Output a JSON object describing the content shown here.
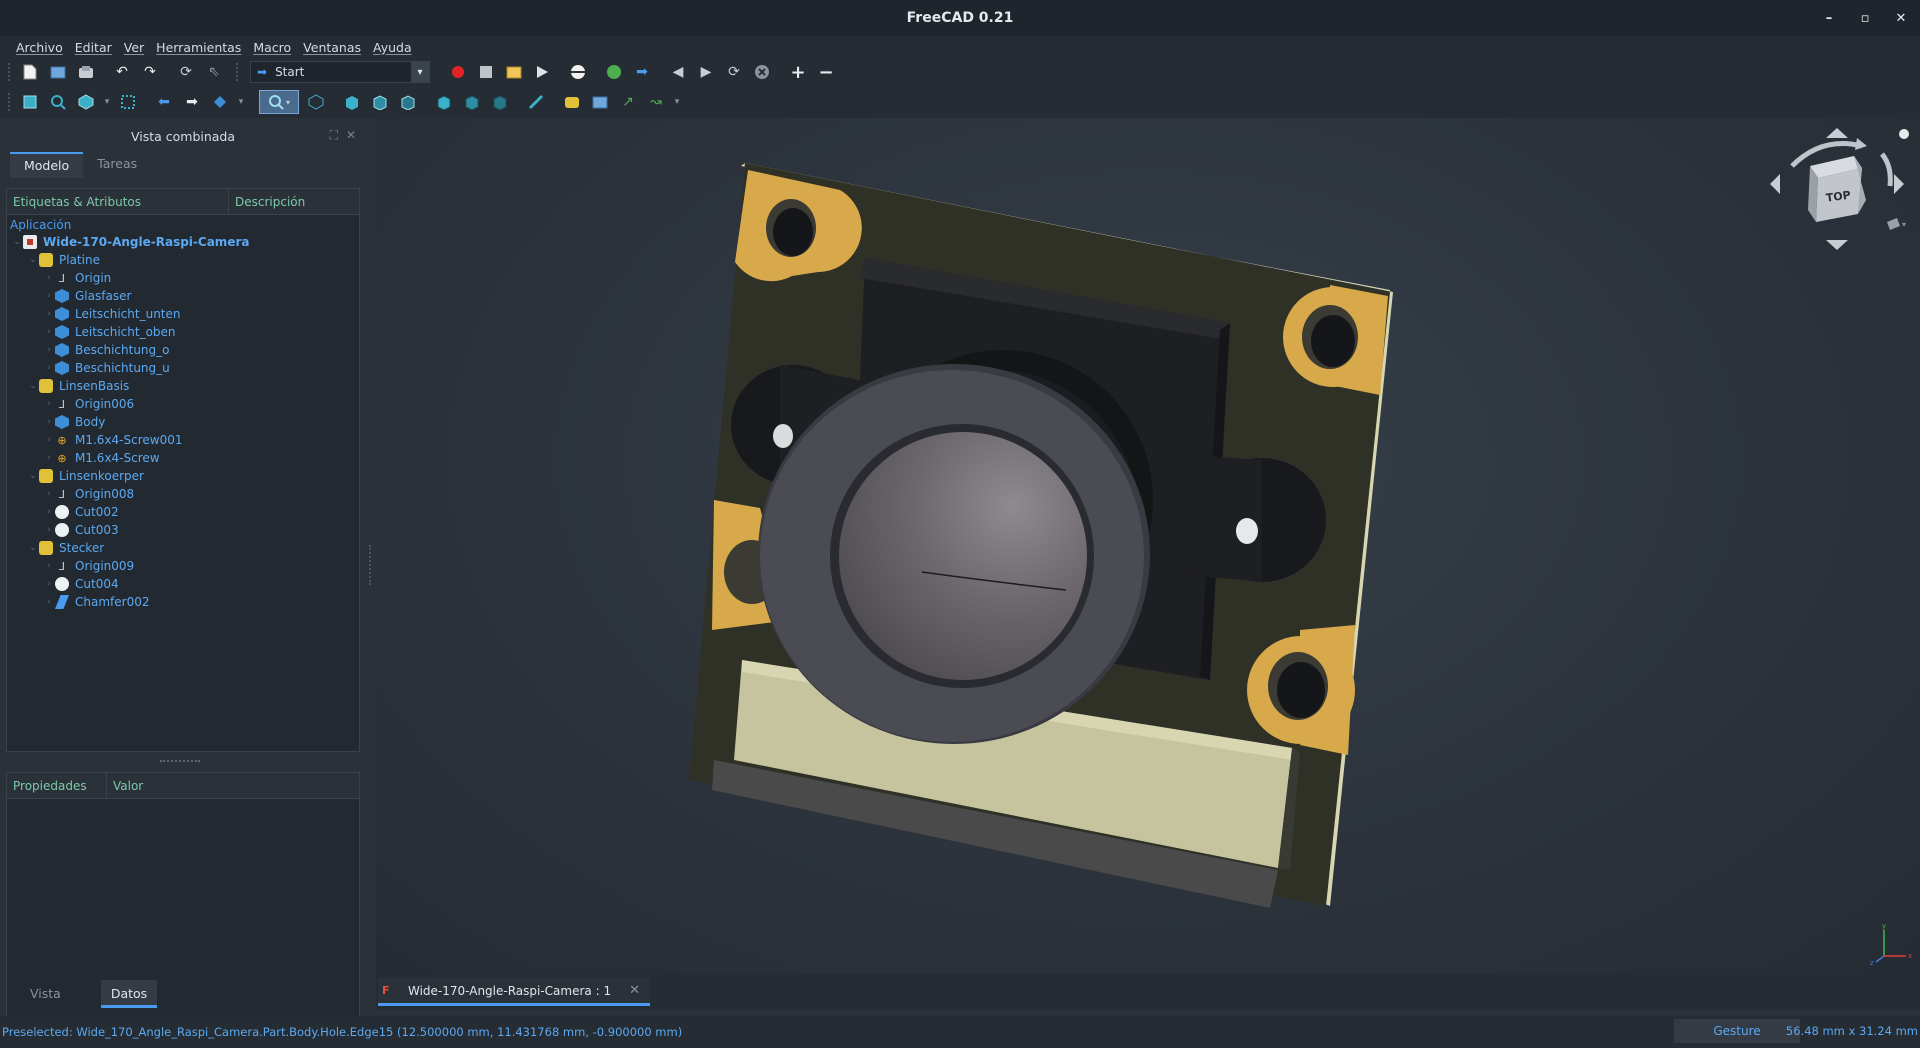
{
  "window": {
    "title": "FreeCAD 0.21",
    "minimize": "–",
    "maximize": "▫",
    "close": "✕"
  },
  "menubar": [
    "Archivo",
    "Editar",
    "Ver",
    "Herramientas",
    "Macro",
    "Ventanas",
    "Ayuda"
  ],
  "workbench": {
    "label": "Start"
  },
  "toolbar1_icons": [
    "new-document-icon",
    "open-icon",
    "save-icon",
    "undo-icon",
    "redo-icon",
    "refresh-icon",
    "whats-this-icon",
    "record-macro-icon",
    "stop-macro-icon",
    "edit-macro-icon",
    "run-macro-icon",
    "navigation-icon",
    "web-home-icon",
    "web-forward-icon",
    "back-icon",
    "forward-icon",
    "reload-icon",
    "stop-icon",
    "zoom-in-icon",
    "zoom-out-icon"
  ],
  "toolbar2_icons": [
    "fit-all-icon",
    "fit-selection-icon",
    "draw-style-icon",
    "bounding-box-icon",
    "view-back-icon",
    "view-forward-icon",
    "sync-view-icon",
    "std-views-icon",
    "isometric-icon",
    "front-view-icon",
    "top-view-icon",
    "right-view-icon",
    "rear-view-icon",
    "bottom-view-icon",
    "left-view-icon",
    "measure-icon",
    "part-icon",
    "group-icon",
    "link-icon",
    "link-actions-icon"
  ],
  "combo": {
    "title": "Vista combinada",
    "tab_model": "Modelo",
    "tab_tasks": "Tareas"
  },
  "tree": {
    "col_labels": "Etiquetas & Atributos",
    "col_desc": "Descripción",
    "section": "Aplicación",
    "rows": [
      {
        "label": "Wide-170-Angle-Raspi-Camera",
        "level": 0,
        "icon": "doc",
        "bold": true,
        "chev": "⌄"
      },
      {
        "label": "Platine",
        "level": 1,
        "icon": "part",
        "chev": "⌄"
      },
      {
        "label": "Origin",
        "level": 2,
        "icon": "origin",
        "chev": "›"
      },
      {
        "label": "Glasfaser",
        "level": 2,
        "icon": "body",
        "chev": "›"
      },
      {
        "label": "Leitschicht_unten",
        "level": 2,
        "icon": "body",
        "chev": "›"
      },
      {
        "label": "Leitschicht_oben",
        "level": 2,
        "icon": "body",
        "chev": "›"
      },
      {
        "label": "Beschichtung_o",
        "level": 2,
        "icon": "body",
        "chev": "›"
      },
      {
        "label": "Beschichtung_u",
        "level": 2,
        "icon": "body",
        "chev": "›"
      },
      {
        "label": "LinsenBasis",
        "level": 1,
        "icon": "part",
        "chev": "⌄"
      },
      {
        "label": "Origin006",
        "level": 2,
        "icon": "origin",
        "chev": "›"
      },
      {
        "label": "Body",
        "level": 2,
        "icon": "body",
        "chev": "›"
      },
      {
        "label": "M1.6x4-Screw001",
        "level": 2,
        "icon": "screw",
        "chev": "›"
      },
      {
        "label": "M1.6x4-Screw",
        "level": 2,
        "icon": "screw",
        "chev": "›"
      },
      {
        "label": "Linsenkoerper",
        "level": 1,
        "icon": "part",
        "chev": "⌄"
      },
      {
        "label": "Origin008",
        "level": 2,
        "icon": "origin",
        "chev": "›"
      },
      {
        "label": "Cut002",
        "level": 2,
        "icon": "cut",
        "chev": "›"
      },
      {
        "label": "Cut003",
        "level": 2,
        "icon": "cut",
        "chev": "›"
      },
      {
        "label": "Stecker",
        "level": 1,
        "icon": "part",
        "chev": "⌄"
      },
      {
        "label": "Origin009",
        "level": 2,
        "icon": "origin",
        "chev": "›"
      },
      {
        "label": "Cut004",
        "level": 2,
        "icon": "cut",
        "chev": "›"
      },
      {
        "label": "Chamfer002",
        "level": 2,
        "icon": "chamfer",
        "chev": "›"
      }
    ]
  },
  "props": {
    "col_property": "Propiedades",
    "col_value": "Valor"
  },
  "bottom_tabs": {
    "view": "Vista",
    "data": "Datos"
  },
  "navcube": {
    "face": "TOP"
  },
  "axis": {
    "x": "x",
    "y": "y",
    "z": "z"
  },
  "doc_tab": {
    "label": "Wide-170-Angle-Raspi-Camera : 1",
    "close": "✕"
  },
  "status": {
    "preselected": "Preselected: Wide_170_Angle_Raspi_Camera.Part.Body.Hole.Edge15 (12.500000 mm, 11.431768 mm, -0.900000 mm)",
    "nav_style": "Gesture",
    "dimensions": "56.48 mm x 31.24 mm"
  },
  "colors": {
    "accent": "#4a9bef",
    "tree_text": "#5ba9f2",
    "header_text": "#7ec9a8",
    "board": "#2e3026",
    "pads": "#d8a94a",
    "connector": "#c6c49e"
  }
}
